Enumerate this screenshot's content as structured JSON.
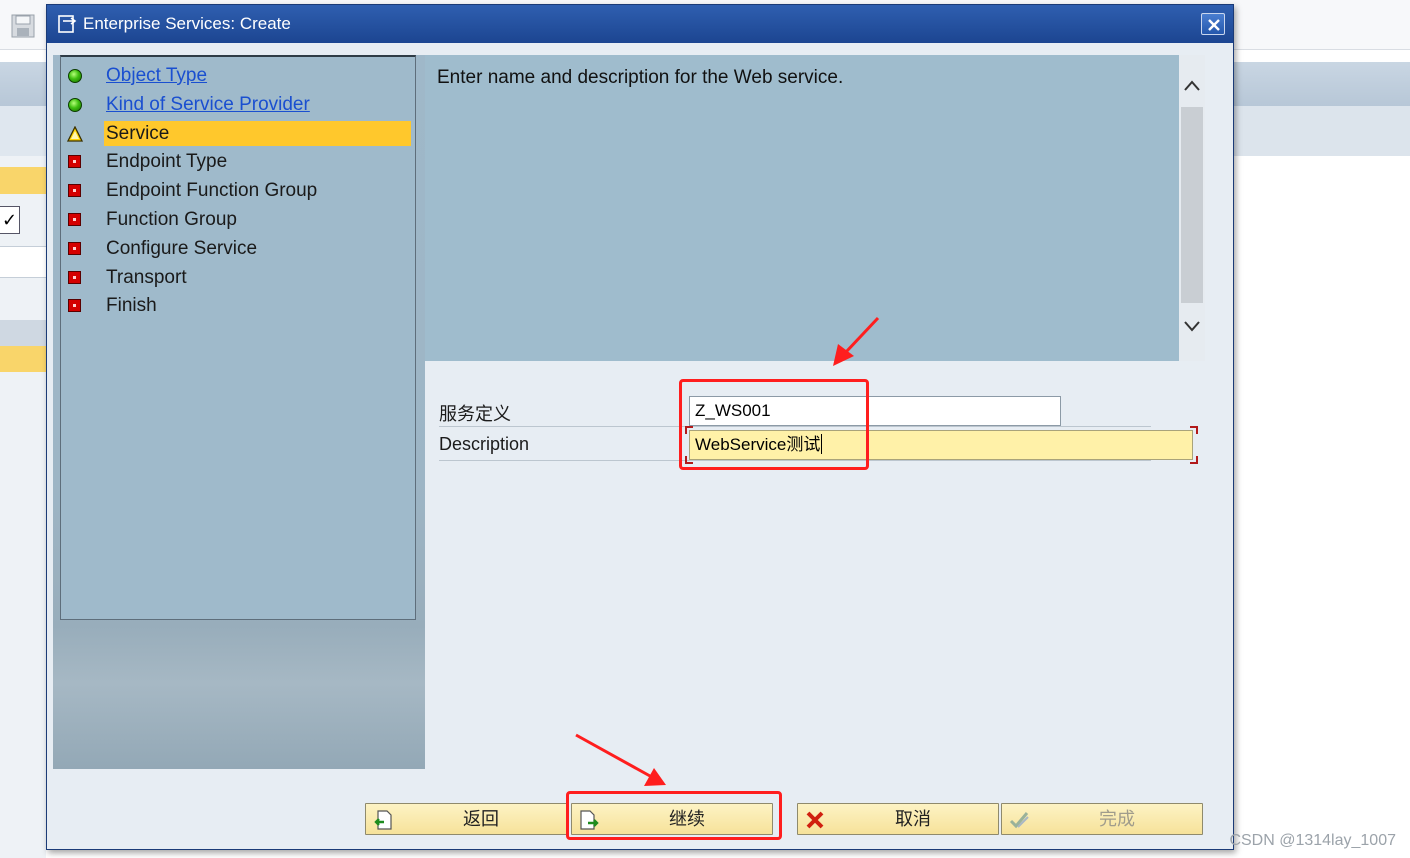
{
  "dialog": {
    "title": "Enterprise Services: Create"
  },
  "roadmap": {
    "steps": [
      {
        "label": "Object Type",
        "status": "done"
      },
      {
        "label": "Kind of Service Provider",
        "status": "done"
      },
      {
        "label": "Service",
        "status": "current"
      },
      {
        "label": "Endpoint Type",
        "status": "pending"
      },
      {
        "label": "Endpoint Function Group",
        "status": "pending"
      },
      {
        "label": "Function Group",
        "status": "pending"
      },
      {
        "label": "Configure Service",
        "status": "pending"
      },
      {
        "label": "Transport",
        "status": "pending"
      },
      {
        "label": "Finish",
        "status": "pending"
      }
    ]
  },
  "info": {
    "text": "Enter name and description for the Web service."
  },
  "form": {
    "service_definition_label": "服务定义",
    "service_definition_value": "Z_WS001",
    "description_label": "Description",
    "description_value": "WebService测试"
  },
  "buttons": {
    "back": "返回",
    "continue": "继续",
    "cancel": "取消",
    "finish": "完成"
  },
  "watermark": "CSDN @1314lay_1007",
  "colors": {
    "title_bar": "#2453a6",
    "current_step": "#ffc82c",
    "annotation": "#ff1e1e",
    "button_fill": "#f8e7a8"
  }
}
